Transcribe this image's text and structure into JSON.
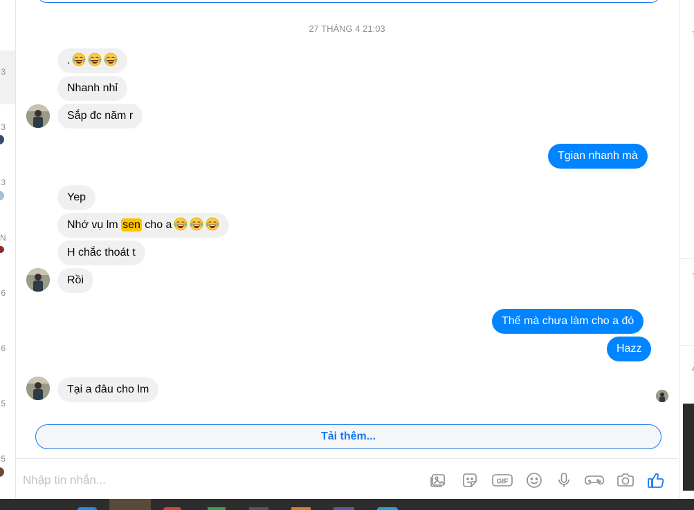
{
  "timestamp": "27 THÁNG 4 21:03",
  "messages": [
    {
      "side": "in",
      "text": ".",
      "emojis": 3
    },
    {
      "side": "in",
      "text": "Nhanh nhỉ"
    },
    {
      "side": "in",
      "text": "Sắp đc năm r"
    },
    {
      "side": "out",
      "text": "Tgian nhanh mà"
    },
    {
      "side": "in",
      "text": "Yep"
    },
    {
      "side": "in",
      "pre": "Nhớ vụ lm ",
      "highlight": "sen",
      "post": " cho a",
      "emojis": 3
    },
    {
      "side": "in",
      "text": "H chắc thoát t"
    },
    {
      "side": "in",
      "text": "Rồi"
    },
    {
      "side": "out",
      "text": "Thế mà chưa làm cho a đó"
    },
    {
      "side": "out",
      "text": "Hazz"
    },
    {
      "side": "in",
      "text": "Tại a đâu cho lm"
    }
  ],
  "load_more_label": "Tải thêm...",
  "composer": {
    "placeholder": "Nhập tin nhắn...",
    "tools": [
      "photo-icon",
      "sticker-icon",
      "gif-icon",
      "emoji-icon",
      "microphone-icon",
      "game-controller-icon",
      "camera-icon",
      "like-icon"
    ],
    "gif_text": "GIF"
  },
  "left_edge_digits": [
    "3",
    "3",
    "3",
    "N",
    "6",
    "6",
    "5",
    "5"
  ],
  "right_edge_marks": [
    "T",
    "T",
    "A"
  ],
  "colors": {
    "outgoing_bubble": "#0084ff",
    "incoming_bubble": "#f0f0f0",
    "highlight": "#ffc300",
    "accent": "#1877f2",
    "icon_gray": "#8a8d91"
  }
}
